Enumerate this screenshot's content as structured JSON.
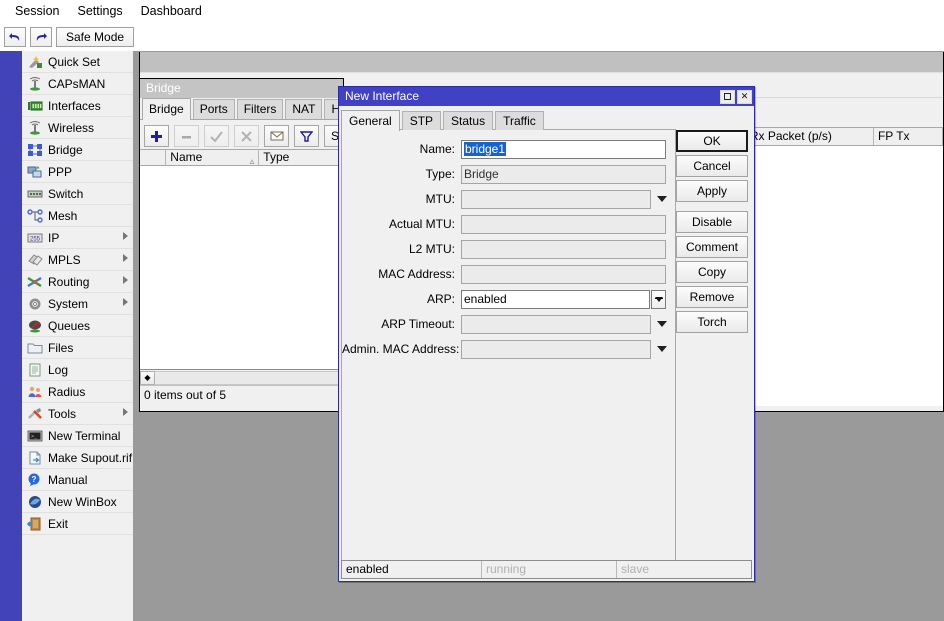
{
  "menubar": {
    "items": [
      {
        "label": "Session"
      },
      {
        "label": "Settings"
      },
      {
        "label": "Dashboard"
      }
    ]
  },
  "toolbar": {
    "undo_icon": "undo-arrow-icon",
    "redo_icon": "redo-arrow-icon",
    "safe_mode_label": "Safe Mode"
  },
  "sidebar": {
    "items": [
      {
        "label": "Quick Set",
        "icon": "quick-set-icon",
        "submenu": false
      },
      {
        "label": "CAPsMAN",
        "icon": "capsman-icon",
        "submenu": false
      },
      {
        "label": "Interfaces",
        "icon": "interfaces-icon",
        "submenu": false
      },
      {
        "label": "Wireless",
        "icon": "wireless-icon",
        "submenu": false
      },
      {
        "label": "Bridge",
        "icon": "bridge-icon",
        "submenu": false
      },
      {
        "label": "PPP",
        "icon": "ppp-icon",
        "submenu": false
      },
      {
        "label": "Switch",
        "icon": "switch-icon",
        "submenu": false
      },
      {
        "label": "Mesh",
        "icon": "mesh-icon",
        "submenu": false
      },
      {
        "label": "IP",
        "icon": "ip-icon",
        "submenu": true
      },
      {
        "label": "MPLS",
        "icon": "mpls-icon",
        "submenu": true
      },
      {
        "label": "Routing",
        "icon": "routing-icon",
        "submenu": true
      },
      {
        "label": "System",
        "icon": "system-gear-icon",
        "submenu": true
      },
      {
        "label": "Queues",
        "icon": "queues-icon",
        "submenu": false
      },
      {
        "label": "Files",
        "icon": "folder-icon",
        "submenu": false
      },
      {
        "label": "Log",
        "icon": "log-icon",
        "submenu": false
      },
      {
        "label": "Radius",
        "icon": "radius-users-icon",
        "submenu": false
      },
      {
        "label": "Tools",
        "icon": "tools-icon",
        "submenu": true
      },
      {
        "label": "New Terminal",
        "icon": "terminal-icon",
        "submenu": false
      },
      {
        "label": "Make Supout.rif",
        "icon": "supout-file-icon",
        "submenu": false
      },
      {
        "label": "Manual",
        "icon": "manual-help-icon",
        "submenu": false
      },
      {
        "label": "New WinBox",
        "icon": "new-winbox-icon",
        "submenu": false
      },
      {
        "label": "Exit",
        "icon": "exit-door-icon",
        "submenu": false
      }
    ]
  },
  "interface_window": {
    "columns": [
      "Rx Packet (p/s)",
      "FP Tx"
    ]
  },
  "bridge_window": {
    "title": "Bridge",
    "tabs": [
      {
        "label": "Bridge",
        "active": true
      },
      {
        "label": "Ports",
        "active": false
      },
      {
        "label": "Filters",
        "active": false
      },
      {
        "label": "NAT",
        "active": false
      },
      {
        "label": "Hosts",
        "active": false
      }
    ],
    "toolbar": [
      {
        "name": "add-button",
        "glyph": "+",
        "icon": "plus-icon",
        "disabled": false
      },
      {
        "name": "remove-button",
        "glyph": "–",
        "icon": "minus-icon",
        "disabled": true
      },
      {
        "name": "enable-button",
        "glyph": "✓",
        "icon": "check-icon",
        "disabled": true
      },
      {
        "name": "disable-button",
        "glyph": "✗",
        "icon": "cross-icon",
        "disabled": true
      },
      {
        "name": "comment-button",
        "glyph": "▤",
        "icon": "comment-icon",
        "disabled": false
      },
      {
        "name": "filter-button",
        "glyph": "▽",
        "icon": "funnel-icon",
        "disabled": false
      },
      {
        "name": "settings-button",
        "glyph": "S",
        "icon": "settings-s-icon",
        "disabled": false
      }
    ],
    "columns": [
      {
        "label": "Name",
        "sorted": true
      },
      {
        "label": "Type",
        "sorted": false
      }
    ],
    "status": "0 items out of 5"
  },
  "dialog": {
    "title": "New Interface",
    "window_buttons": {
      "maximize": "maximize-icon",
      "close": "close-icon"
    },
    "tabs": [
      {
        "label": "General",
        "active": true
      },
      {
        "label": "STP",
        "active": false
      },
      {
        "label": "Status",
        "active": false
      },
      {
        "label": "Traffic",
        "active": false
      }
    ],
    "fields": [
      {
        "label": "Name:",
        "value": "bridge1",
        "kind": "text-selected",
        "dropdown": "none"
      },
      {
        "label": "Type:",
        "value": "Bridge",
        "kind": "readonly",
        "dropdown": "none"
      },
      {
        "label": "MTU:",
        "value": "",
        "kind": "blank",
        "dropdown": "arrow"
      },
      {
        "label": "Actual MTU:",
        "value": "",
        "kind": "blank",
        "dropdown": "none"
      },
      {
        "label": "L2 MTU:",
        "value": "",
        "kind": "blank",
        "dropdown": "none"
      },
      {
        "label": "MAC Address:",
        "value": "",
        "kind": "blank",
        "dropdown": "none"
      },
      {
        "label": "ARP:",
        "value": "enabled",
        "kind": "text",
        "dropdown": "button"
      },
      {
        "label": "ARP Timeout:",
        "value": "",
        "kind": "blank",
        "dropdown": "arrow"
      },
      {
        "label": "Admin. MAC Address:",
        "value": "",
        "kind": "blank",
        "dropdown": "arrow"
      }
    ],
    "buttons": [
      {
        "label": "OK",
        "primary": true,
        "gap": false
      },
      {
        "label": "Cancel",
        "primary": false,
        "gap": false
      },
      {
        "label": "Apply",
        "primary": false,
        "gap": false
      },
      {
        "label": "Disable",
        "primary": false,
        "gap": true
      },
      {
        "label": "Comment",
        "primary": false,
        "gap": false
      },
      {
        "label": "Copy",
        "primary": false,
        "gap": false
      },
      {
        "label": "Remove",
        "primary": false,
        "gap": false
      },
      {
        "label": "Torch",
        "primary": false,
        "gap": false
      }
    ],
    "statusbar": {
      "state": "enabled",
      "running": "running",
      "slave": "slave"
    }
  },
  "colors": {
    "dialog_title_bg": "#4141c4",
    "left_rail": "#4343b8",
    "desktop": "#9a9a9a",
    "selection_blue": "#1763c8",
    "window_face": "#f0f0f0"
  }
}
